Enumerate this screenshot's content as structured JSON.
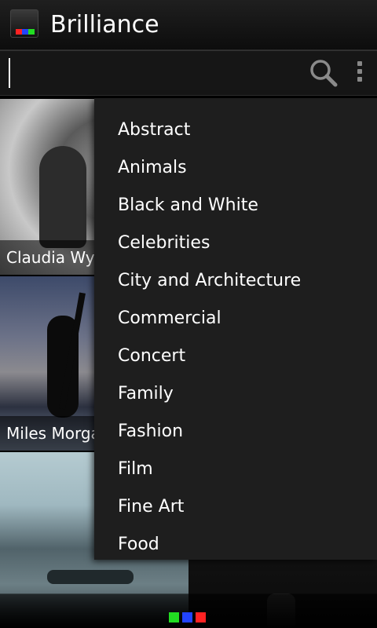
{
  "app": {
    "title": "Brilliance"
  },
  "search": {
    "value": "",
    "placeholder": ""
  },
  "icons": {
    "search": "search-icon",
    "overflow": "overflow-menu-icon",
    "app": "app-icon"
  },
  "photos": [
    {
      "caption": "Claudia Wyc"
    },
    {
      "caption": "Miles Morga"
    },
    {
      "caption": ""
    },
    {
      "caption": ""
    }
  ],
  "categories": [
    "Abstract",
    "Animals",
    "Black and White",
    "Celebrities",
    "City and Architecture",
    "Commercial",
    "Concert",
    "Family",
    "Fashion",
    "Film",
    "Fine Art",
    "Food"
  ],
  "colors": {
    "dropdown_bg": "#1e1e1e",
    "logo_red": "#ff2222",
    "logo_green": "#22dd22",
    "logo_blue": "#2244ff"
  }
}
